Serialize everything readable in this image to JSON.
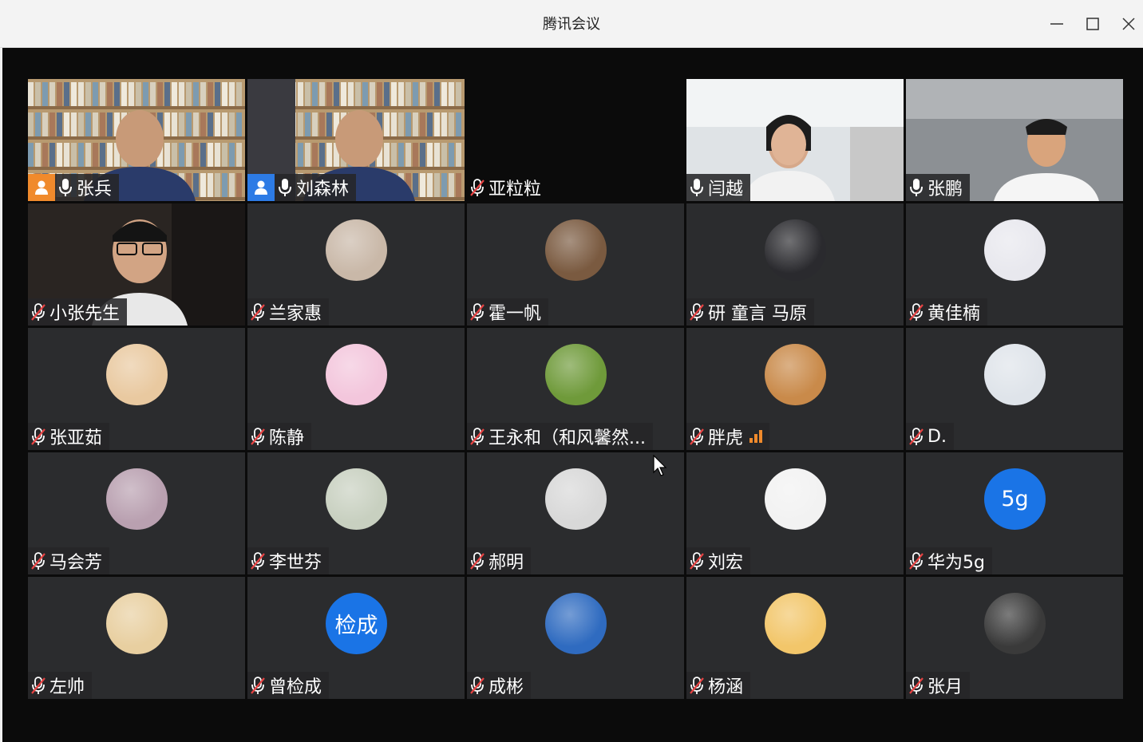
{
  "window": {
    "title": "腾讯会议",
    "minimize_icon": "minimize-icon",
    "maximize_icon": "maximize-icon",
    "close_icon": "close-icon"
  },
  "participants": [
    {
      "name": "张兵",
      "video": true,
      "host": "orange",
      "mic": "on",
      "scene": "bookshelf"
    },
    {
      "name": "刘森林",
      "video": true,
      "host": "blue",
      "mic": "on",
      "speaking": true,
      "scene": "bookshelf2"
    },
    {
      "name": "亚粒粒",
      "video": false,
      "blank": true,
      "mic": "muted"
    },
    {
      "name": "闫越",
      "video": true,
      "mic": "on",
      "scene": "office"
    },
    {
      "name": "张鹏",
      "video": true,
      "mic": "on",
      "scene": "room"
    },
    {
      "name": "小张先生",
      "video": true,
      "mic": "muted",
      "scene": "dark"
    },
    {
      "name": "兰家惠",
      "avatar_color": "#c9b8a8",
      "mic": "muted"
    },
    {
      "name": "霍一帆",
      "avatar_color": "#7a5a40",
      "mic": "muted"
    },
    {
      "name": "研 童言 马原",
      "avatar_color": "#2a2a2e",
      "mic": "muted"
    },
    {
      "name": "黄佳楠",
      "avatar_color": "#e8e8ee",
      "mic": "muted"
    },
    {
      "name": "张亚茹",
      "avatar_color": "#e9c9a0",
      "mic": "muted"
    },
    {
      "name": "陈静",
      "avatar_color": "#f3c6dc",
      "mic": "muted"
    },
    {
      "name": "王永和（和风馨然...",
      "avatar_color": "#6f9a3a",
      "mic": "muted"
    },
    {
      "name": "胖虎",
      "avatar_color": "#c98a4a",
      "mic": "muted",
      "signal": true
    },
    {
      "name": "D.",
      "avatar_color": "#dfe4ea",
      "mic": "muted"
    },
    {
      "name": " 马会芳",
      "avatar_color": "#b9a0b0",
      "mic": "muted"
    },
    {
      "name": "李世芬",
      "avatar_color": "#c8d0c0",
      "mic": "muted"
    },
    {
      "name": "郝明",
      "avatar_color": "#d8d8d8",
      "mic": "muted"
    },
    {
      "name": "刘宏",
      "avatar_color": "#f2f2f2",
      "mic": "muted"
    },
    {
      "name": "华为5g",
      "avatar_text": "5g",
      "mic": "muted"
    },
    {
      "name": "左帅",
      "avatar_color": "#e8cfa0",
      "mic": "muted"
    },
    {
      "name": "曾检成",
      "avatar_text": "检成",
      "mic": "muted"
    },
    {
      "name": "成彬",
      "avatar_color": "#2f6bc0",
      "mic": "muted"
    },
    {
      "name": "杨涵",
      "avatar_color": "#f2c66a",
      "mic": "muted"
    },
    {
      "name": "张月",
      "avatar_color": "#3a3a3a",
      "mic": "muted"
    }
  ]
}
